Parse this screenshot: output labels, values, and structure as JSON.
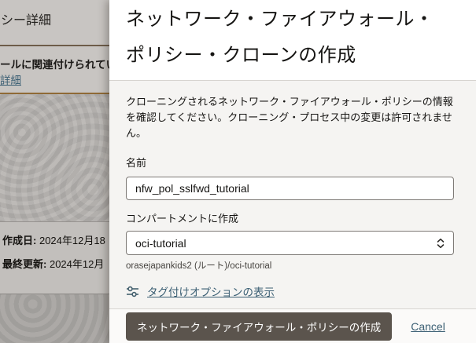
{
  "colors": {
    "link": "#3a5e73",
    "primary_button_bg": "#5b544d",
    "dialog_body_bg": "#f5f4f2",
    "brown_divider": "#8f6a36",
    "backdrop_gray": "#c8c5c2"
  },
  "background_page": {
    "heading_fragment": "シー詳細",
    "section_text_fragment": "ールに関連付けられてい",
    "detail_link_fragment": "詳細",
    "created": {
      "label": "作成日:",
      "value": "2024年12月18"
    },
    "updated": {
      "label": "最終更新:",
      "value": "2024年12月"
    }
  },
  "dialog": {
    "title_lines": [
      "ネットワーク・ファイアウォール・",
      "ポリシー・クローンの作成"
    ],
    "description": "クローニングされるネットワーク・ファイアウォール・ポリシーの情報を確認してください。クローニング・プロセス中の変更は許可されません。",
    "name_field": {
      "label": "名前",
      "value": "nfw_pol_sslfwd_tutorial"
    },
    "compartment_field": {
      "label": "コンパートメントに作成",
      "selected_value": "oci-tutorial",
      "helper": "orasejapankids2 (ルート)/oci-tutorial"
    },
    "tag_options_link": "タグ付けオプションの表示",
    "footer": {
      "submit_label": "ネットワーク・ファイアウォール・ポリシーの作成",
      "cancel_label": "Cancel"
    }
  }
}
